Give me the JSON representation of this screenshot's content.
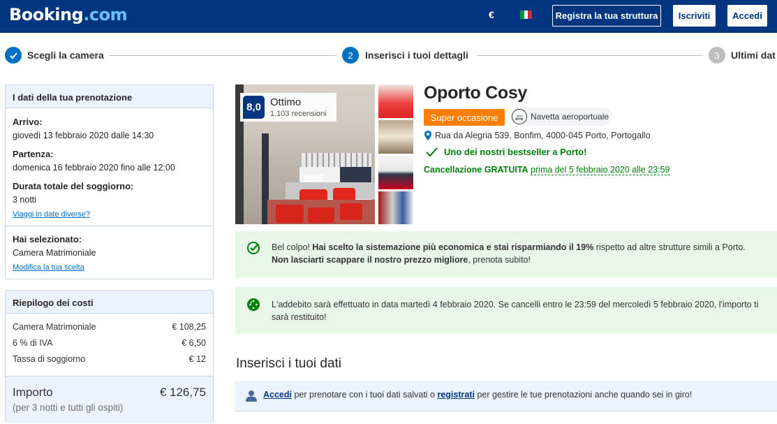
{
  "header": {
    "logo_main": "Booking",
    "logo_suffix": ".com",
    "currency": "€",
    "register_property": "Registra la tua struttura",
    "signup": "Iscriviti",
    "login": "Accedi"
  },
  "progress": {
    "steps": [
      {
        "number": "✓",
        "label": "Scegli la camera",
        "state": "completed"
      },
      {
        "number": "2",
        "label": "Inserisci i tuoi dettagli",
        "state": "current"
      },
      {
        "number": "3",
        "label": "Ultimi dat",
        "state": "upcoming"
      }
    ]
  },
  "booking_details": {
    "title": "I dati della tua prenotazione",
    "checkin_label": "Arrivo:",
    "checkin_value": "giovedì 13 febbraio 2020 dalle 14:30",
    "checkout_label": "Partenza:",
    "checkout_value": "domenica 16 febbraio 2020 fino alle 12:00",
    "duration_label": "Durata totale del soggiorno:",
    "duration_value": "3 notti",
    "change_dates_link": "Viaggi in date diverse?",
    "selected_label": "Hai selezionato:",
    "selected_value": "Camera Matrimoniale",
    "change_selection_link": "Modifica la tua scelta"
  },
  "cost_summary": {
    "title": "Riepilogo dei costi",
    "rows": [
      {
        "label": "Camera Matrimoniale",
        "value": "€ 108,25"
      },
      {
        "label": "6 % di IVA",
        "value": "€ 6,50"
      },
      {
        "label": "Tassa di soggiorno",
        "value": "€ 12"
      }
    ],
    "total_label": "Importo",
    "total_value": "€ 126,75",
    "total_note": "(per 3 notti e tutti gli ospiti)"
  },
  "hotel": {
    "name": "Oporto Cosy",
    "score": "8,0",
    "score_word": "Ottimo",
    "reviews": "1.103 recensioni",
    "deal_badge": "Super occasione",
    "shuttle": "Navetta aeroportuale",
    "address": "Rua da Alegria 539, Bonfim, 4000-045 Porto, Portogallo",
    "bestseller": "Uno dei nostri bestseller a Porto!",
    "cancel_bold": "Cancellazione GRATUITA",
    "cancel_rest": "prima del 5 febbraio 2020 alle 23:59"
  },
  "notices": {
    "deal_intro": "Bel colpo!",
    "deal_bold_1": "Hai scelto la sistemazione più economica e stai risparmiando il 19%",
    "deal_rest_1": "rispetto ad altre strutture simili a Porto.",
    "deal_bold_2": "Non lasciarti scappare il nostro prezzo migliore",
    "deal_rest_2": ", prenota subito!",
    "charge_text": "L'addebito sarà effettuato in data martedì 4 febbraio 2020. Se cancelli entro le 23:59 del mercoledì 5 febbraio 2020, l'importo ti sarà restituito!"
  },
  "details_form": {
    "title": "Inserisci i tuoi dati",
    "login_link": "Accedi",
    "text_1": "per prenotare con i tuoi dati salvati o",
    "register_link": "registrati",
    "text_2": "per gestire le tue prenotazioni anche quando sei in giro!"
  },
  "colors": {
    "brand": "#003580",
    "accent_blue": "#0071c2",
    "success": "#008009",
    "deal_orange": "#ff8000"
  }
}
